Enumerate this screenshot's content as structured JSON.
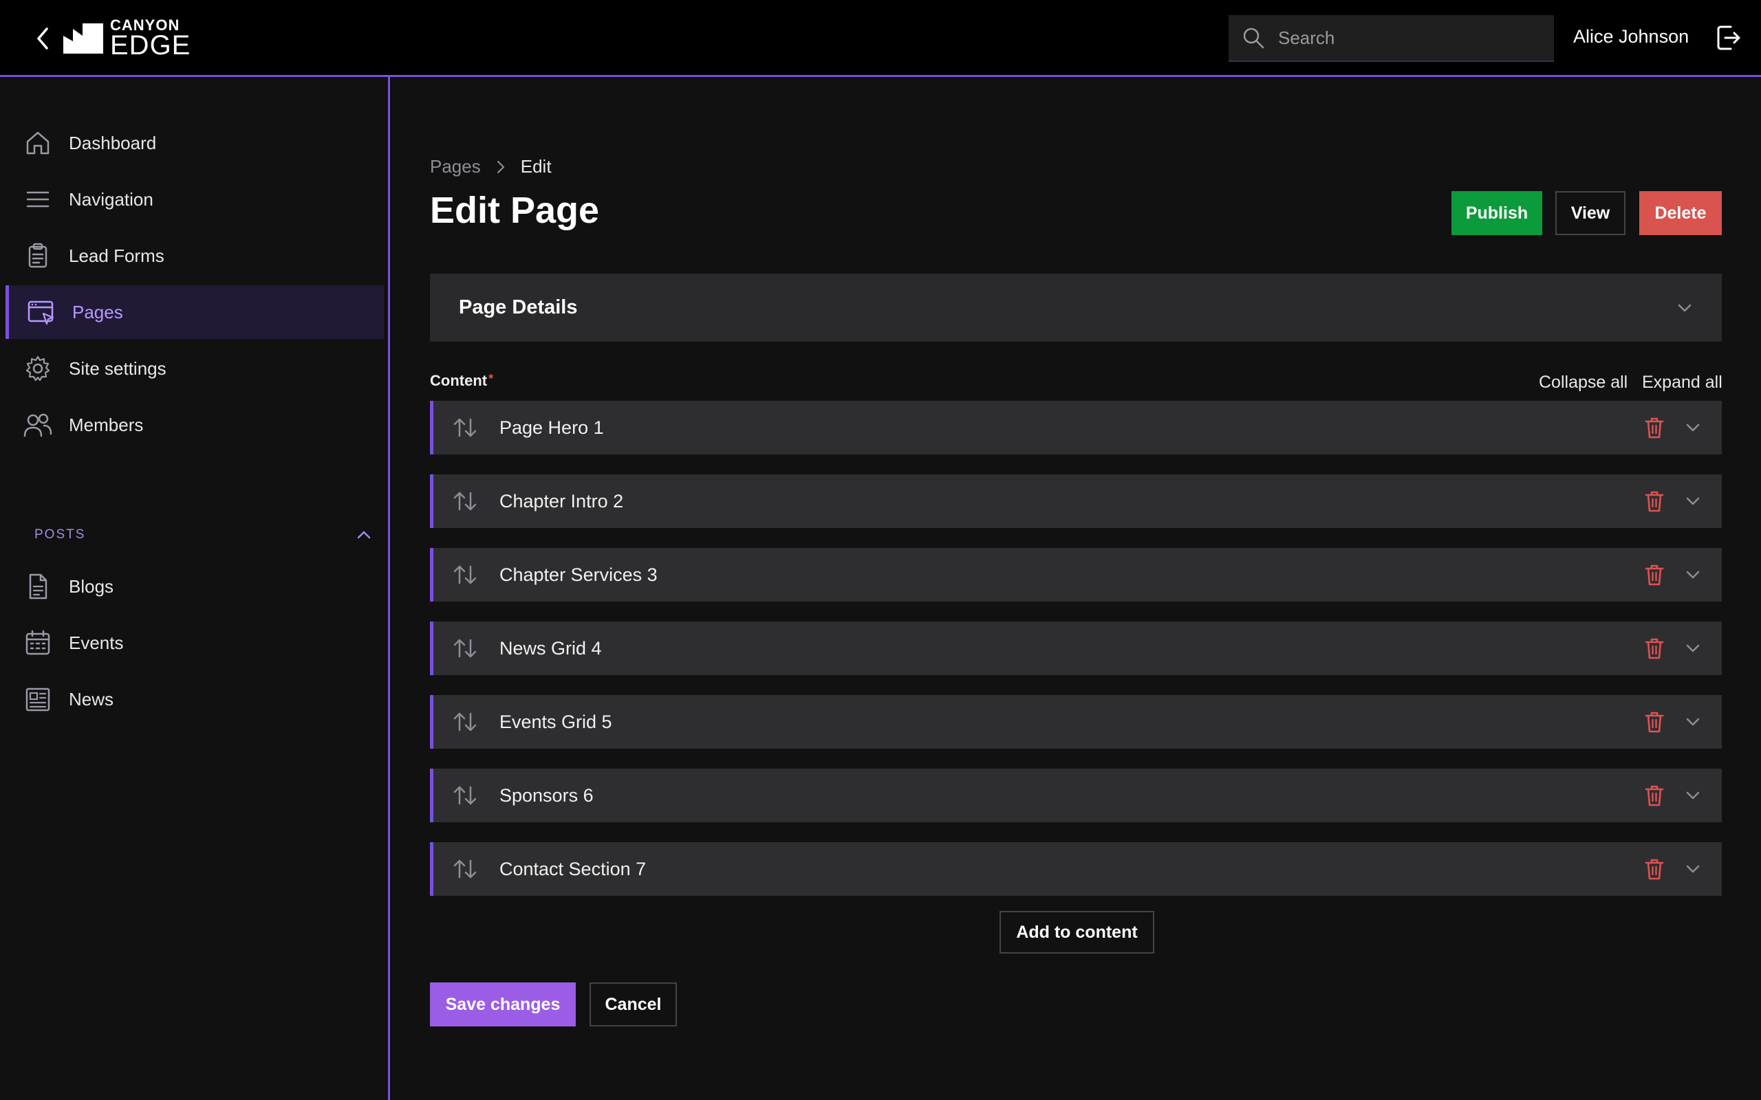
{
  "app": {
    "logo_top": "CANYON",
    "logo_bottom": "EDGE"
  },
  "header": {
    "search_placeholder": "Search",
    "user_name": "Alice Johnson"
  },
  "sidebar": {
    "items": [
      {
        "label": "Dashboard",
        "icon": "home-icon"
      },
      {
        "label": "Navigation",
        "icon": "menu-icon"
      },
      {
        "label": "Lead Forms",
        "icon": "clipboard-icon"
      },
      {
        "label": "Pages",
        "icon": "browser-window-icon",
        "active": true
      },
      {
        "label": "Site settings",
        "icon": "gear-icon"
      },
      {
        "label": "Members",
        "icon": "users-icon"
      }
    ],
    "posts_header": "POSTS",
    "posts_items": [
      {
        "label": "Blogs",
        "icon": "document-icon"
      },
      {
        "label": "Events",
        "icon": "calendar-icon"
      },
      {
        "label": "News",
        "icon": "newspaper-icon"
      }
    ]
  },
  "main": {
    "breadcrumb": {
      "parent": "Pages",
      "current": "Edit"
    },
    "title": "Edit Page",
    "buttons": {
      "publish": "Publish",
      "view": "View",
      "delete": "Delete"
    },
    "details_panel_title": "Page Details",
    "content_label": "Content",
    "required_mark": "*",
    "collapse_all": "Collapse all",
    "expand_all": "Expand all",
    "blocks": [
      {
        "title": "Page Hero 1"
      },
      {
        "title": "Chapter Intro 2"
      },
      {
        "title": "Chapter Services 3"
      },
      {
        "title": "News Grid 4"
      },
      {
        "title": "Events Grid 5"
      },
      {
        "title": "Sponsors 6"
      },
      {
        "title": "Contact Section 7"
      }
    ],
    "add_to_content": "Add to content",
    "save_changes": "Save changes",
    "cancel": "Cancel"
  },
  "colors": {
    "accent": "#7b4fe0",
    "publish": "#0c9b3a",
    "delete": "#d9534f",
    "save": "#9b5de5",
    "trash": "#e05252"
  }
}
